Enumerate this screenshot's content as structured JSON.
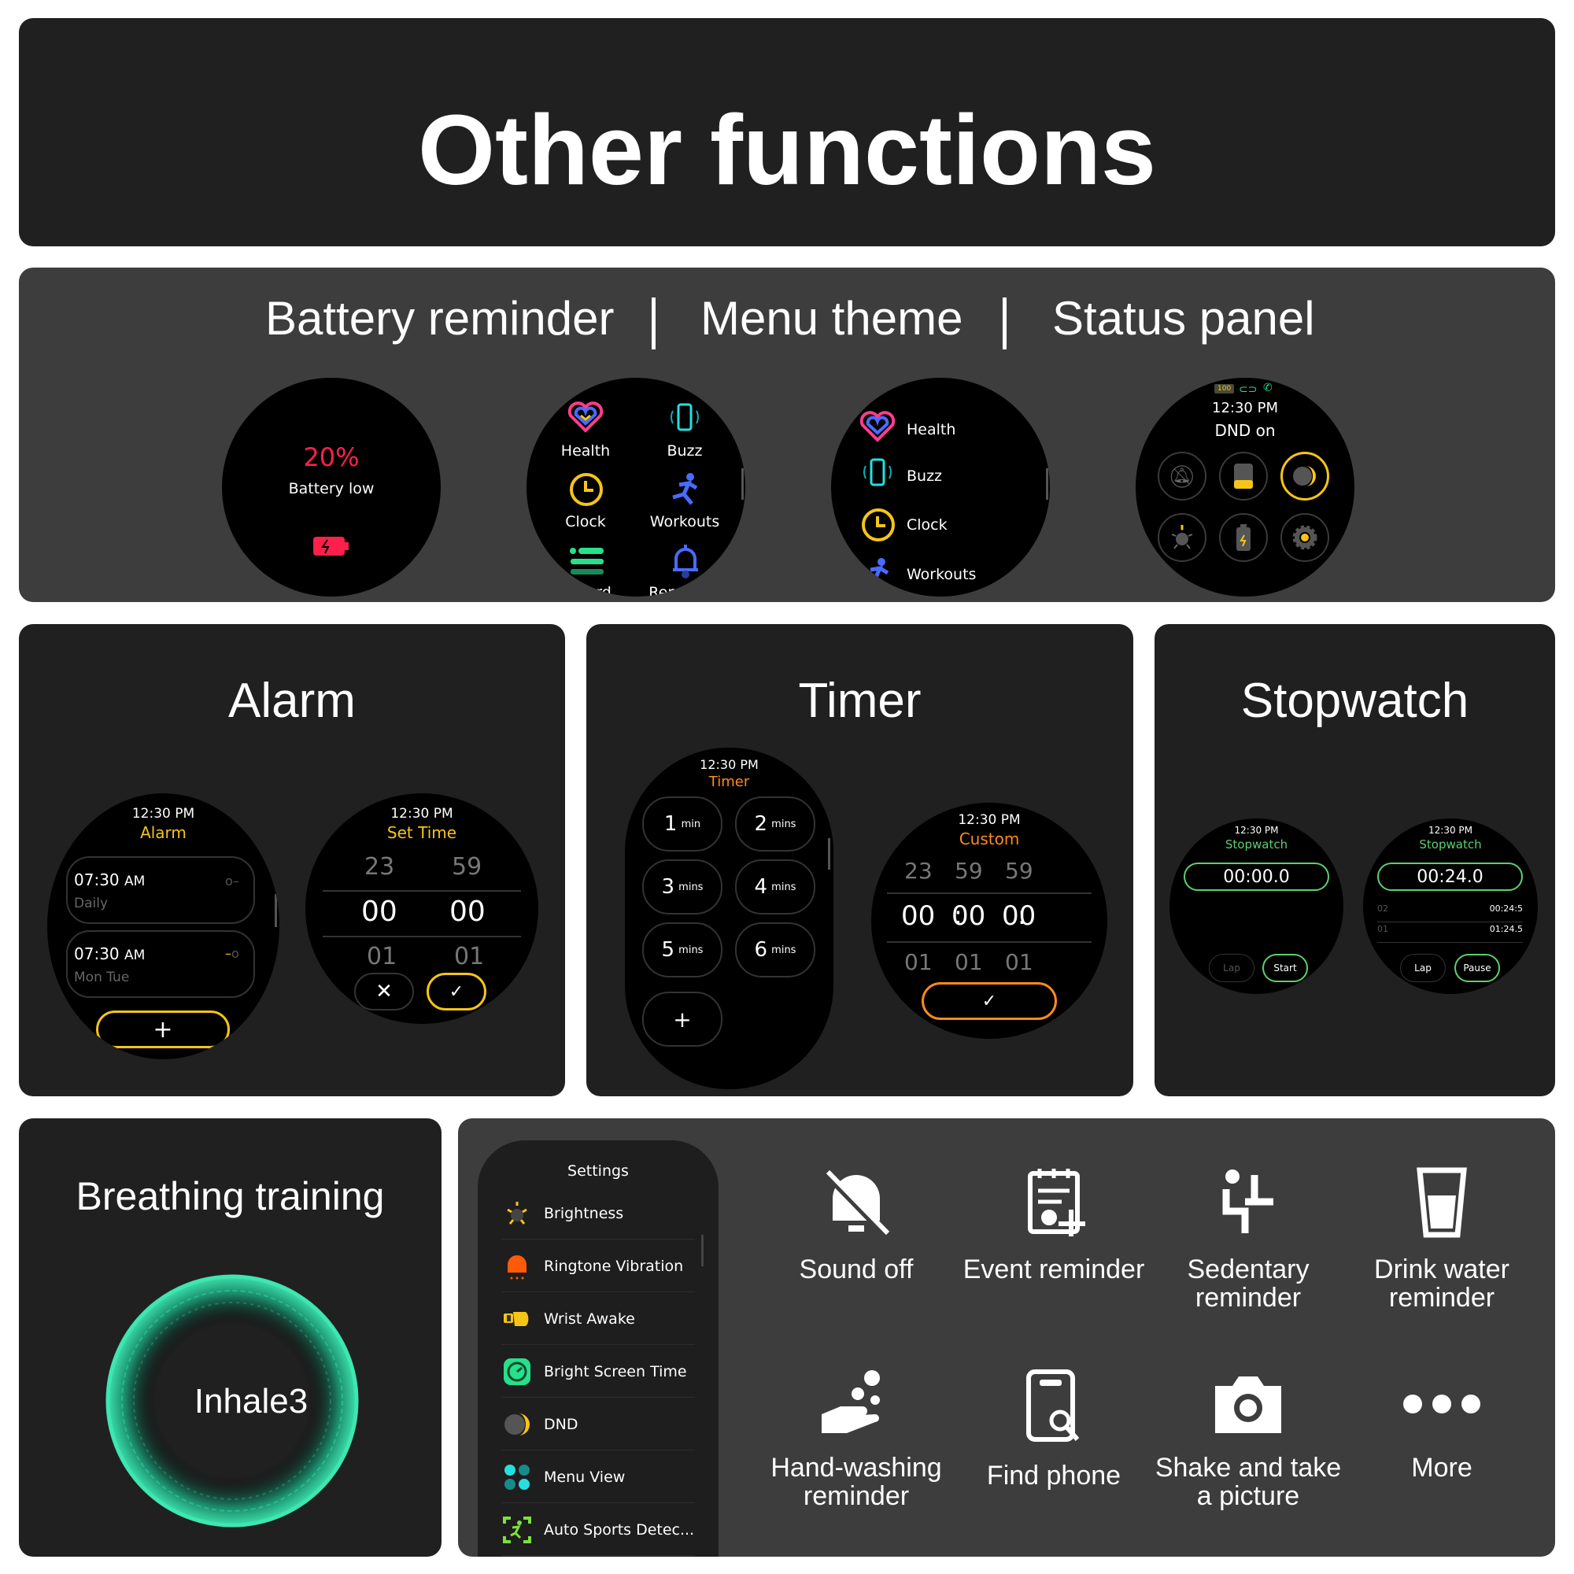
{
  "title": "Other functions",
  "section2": {
    "headers": [
      "Battery reminder",
      "Menu theme",
      "Status panel"
    ],
    "battery": {
      "percent": "20%",
      "label": "Battery low",
      "color": "#ff1f4b"
    },
    "menu_grid": {
      "items": [
        {
          "label": "Health",
          "icon": "heart-icon"
        },
        {
          "label": "Buzz",
          "icon": "phone-vibrate-icon"
        },
        {
          "label": "Clock",
          "icon": "clock-icon"
        },
        {
          "label": "Workouts",
          "icon": "running-icon"
        },
        {
          "label": "Record",
          "icon": "list-icon"
        },
        {
          "label": "Reminder",
          "icon": "bell-icon"
        }
      ]
    },
    "menu_list": {
      "items": [
        {
          "label": "Health",
          "icon": "heart-icon"
        },
        {
          "label": "Buzz",
          "icon": "phone-vibrate-icon"
        },
        {
          "label": "Clock",
          "icon": "clock-icon"
        },
        {
          "label": "Workouts",
          "icon": "running-icon"
        }
      ]
    },
    "status": {
      "battery": "100",
      "time": "12:30 PM",
      "dnd": "DND on",
      "buttons": [
        "bell-off-icon",
        "find-phone-icon",
        "moon-icon",
        "brightness-icon",
        "battery-saver-icon",
        "settings-icon"
      ],
      "active": "moon-icon"
    }
  },
  "alarm": {
    "title": "Alarm",
    "list": {
      "time": "12:30 PM",
      "header": "Alarm",
      "items": [
        {
          "time": "07:30",
          "ampm": "AM",
          "repeat": "Daily",
          "on": false
        },
        {
          "time": "07:30",
          "ampm": "AM",
          "repeat": "Mon Tue",
          "on": true
        }
      ],
      "add": "+"
    },
    "set": {
      "time": "12:30 PM",
      "header": "Set Time",
      "above": [
        "23",
        "59"
      ],
      "current": [
        "00",
        "00"
      ],
      "below": [
        "01",
        "01"
      ]
    }
  },
  "timer": {
    "title": "Timer",
    "presets": {
      "time": "12:30 PM",
      "header": "Timer",
      "items": [
        {
          "n": "1",
          "u": "min"
        },
        {
          "n": "2",
          "u": "mins"
        },
        {
          "n": "3",
          "u": "mins"
        },
        {
          "n": "4",
          "u": "mins"
        },
        {
          "n": "5",
          "u": "mins"
        },
        {
          "n": "6",
          "u": "mins"
        }
      ],
      "add": "+"
    },
    "custom": {
      "time": "12:30 PM",
      "header": "Custom",
      "above": [
        "23",
        "59",
        "59"
      ],
      "current": [
        "00",
        "00",
        "00"
      ],
      "below": [
        "01",
        "01",
        "01"
      ],
      "sep": ":"
    }
  },
  "stopwatch": {
    "title": "Stopwatch",
    "idle": {
      "time": "12:30 PM",
      "header": "Stopwatch",
      "value": "00:00.0",
      "lap": "Lap",
      "start": "Start"
    },
    "running": {
      "time": "12:30 PM",
      "header": "Stopwatch",
      "value": "00:24.0",
      "laps": [
        {
          "n": "02",
          "t": "00:24:5"
        },
        {
          "n": "01",
          "t": "01:24.5"
        }
      ],
      "lap": "Lap",
      "pause": "Pause"
    }
  },
  "breathing": {
    "title": "Breathing training",
    "label": "Inhale3",
    "color": "#3ee6b0"
  },
  "settings": {
    "header": "Settings",
    "items": [
      "Brightness",
      "Ringtone Vibration",
      "Wrist Awake",
      "Bright Screen Time",
      "DND",
      "Menu View",
      "Auto Sports Detec..."
    ]
  },
  "features": [
    {
      "label": "Sound off"
    },
    {
      "label": "Event reminder"
    },
    {
      "label": "Sedentary reminder"
    },
    {
      "label": "Drink water reminder"
    },
    {
      "label": "Hand-washing reminder"
    },
    {
      "label": "Find phone"
    },
    {
      "label": "Shake and take a picture"
    },
    {
      "label": "More"
    }
  ]
}
